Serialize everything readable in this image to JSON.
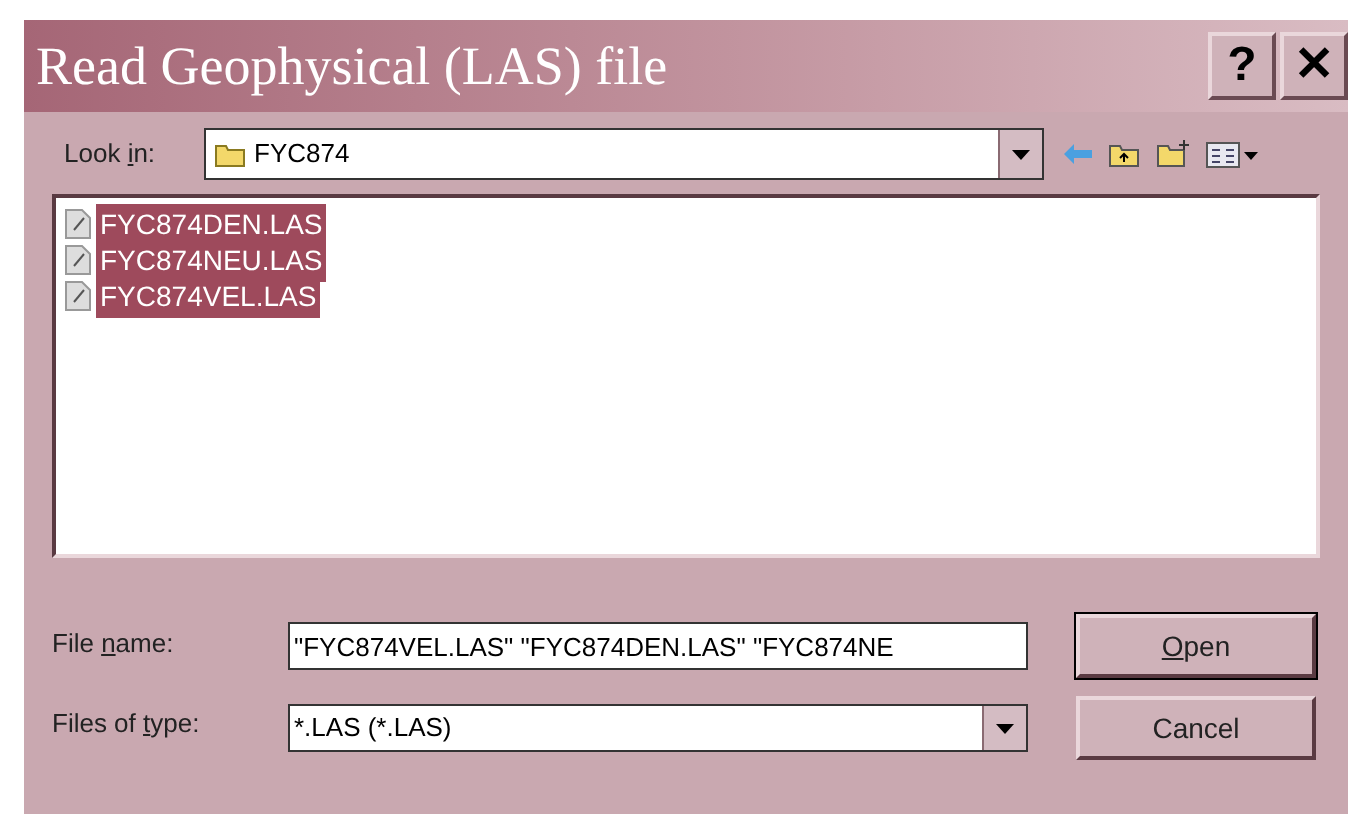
{
  "window": {
    "title": "Read Geophysical (LAS) file",
    "title_buttons": [
      "?",
      "✕"
    ]
  },
  "look_in": {
    "label": {
      "before": "Look ",
      "key": "i",
      "after": "n:"
    },
    "value": "FYC874"
  },
  "files": [
    {
      "name": "FYC874DEN.LAS",
      "selected": true
    },
    {
      "name": "FYC874NEU.LAS",
      "selected": true
    },
    {
      "name": "FYC874VEL.LAS",
      "selected": true
    }
  ],
  "file_name": {
    "label": {
      "before": "File ",
      "key": "n",
      "after": "ame:"
    },
    "value": "\"FYC874VEL.LAS\" \"FYC874DEN.LAS\" \"FYC874NE"
  },
  "file_type": {
    "label": {
      "before": "Files of ",
      "key": "t",
      "after": "ype:"
    },
    "value": "*.LAS (*.LAS)"
  },
  "buttons": [
    {
      "label": {
        "key": "O",
        "after": "pen"
      },
      "default": true
    },
    {
      "label": {
        "before": "Cancel"
      },
      "default": false
    }
  ]
}
